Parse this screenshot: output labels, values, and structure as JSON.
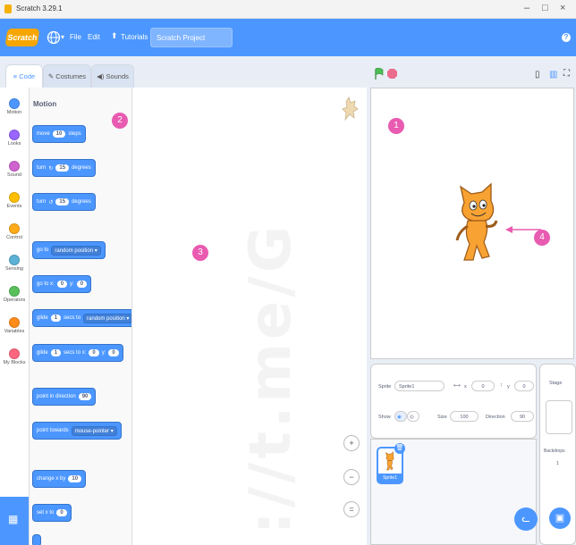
{
  "window": {
    "title": "Scratch 3.29.1",
    "minimize": "–",
    "maximize": "□",
    "close": "×"
  },
  "menubar": {
    "logo": "Scratch",
    "file": "File",
    "edit": "Edit",
    "tutorials": "Tutorials",
    "project_title": "Scratch Project",
    "help": "?"
  },
  "tabs": {
    "code": "Code",
    "costumes": "Costumes",
    "sounds": "Sounds"
  },
  "categories": [
    {
      "label": "Motion",
      "color": "#4c97ff"
    },
    {
      "label": "Looks",
      "color": "#9966ff"
    },
    {
      "label": "Sound",
      "color": "#cf63cf"
    },
    {
      "label": "Events",
      "color": "#ffbf00"
    },
    {
      "label": "Control",
      "color": "#ffab19"
    },
    {
      "label": "Sensing",
      "color": "#5cb1d6"
    },
    {
      "label": "Operators",
      "color": "#59c059"
    },
    {
      "label": "Variables",
      "color": "#ff8c1a"
    },
    {
      "label": "My Blocks",
      "color": "#ff6680"
    }
  ],
  "palette": {
    "title": "Motion",
    "blocks": {
      "move": {
        "pre": "move",
        "val": "10",
        "post": "steps"
      },
      "turn_right": {
        "pre": "turn",
        "icon": "↻",
        "val": "15",
        "post": "degrees"
      },
      "turn_left": {
        "pre": "turn",
        "icon": "↺",
        "val": "15",
        "post": "degrees"
      },
      "goto": {
        "pre": "go to",
        "drop": "random position ▾"
      },
      "gotoxy": {
        "pre": "go to x:",
        "x": "0",
        "mid": "y:",
        "y": "0"
      },
      "glide_to": {
        "pre": "glide",
        "val": "1",
        "mid": "secs to",
        "drop": "random position ▾"
      },
      "glide_xy": {
        "pre": "glide",
        "val": "1",
        "mid": "secs to x:",
        "x": "0",
        "mid2": "y:",
        "y": "0"
      },
      "point_dir": {
        "pre": "point in direction",
        "val": "90"
      },
      "point_towards": {
        "pre": "point towards",
        "drop": "mouse-pointer ▾"
      },
      "change_x": {
        "pre": "change x by",
        "val": "10"
      },
      "set_x": {
        "pre": "set x to",
        "val": "0"
      }
    }
  },
  "markers": {
    "m1": "1",
    "m2": "2",
    "m3": "3",
    "m4": "4"
  },
  "watermark": "://t.me/G",
  "zoom": {
    "in": "+",
    "out": "−",
    "reset": "="
  },
  "sprite_info": {
    "sprite_label": "Sprite",
    "sprite_value": "Sprite1",
    "x_label": "x",
    "x_value": "0",
    "y_label": "y",
    "y_value": "0",
    "show_label": "Show",
    "size_label": "Size",
    "size_value": "100",
    "direction_label": "Direction",
    "direction_value": "90"
  },
  "sprite_list": {
    "thumb_label": "Sprite1"
  },
  "stage_pane": {
    "title": "Stage",
    "backdrops_label": "Backdrops",
    "backdrops_count": "1"
  },
  "colors": {
    "accent": "#4c97ff",
    "marker": "#e85bb0",
    "cat_orange": "#f7a600"
  }
}
